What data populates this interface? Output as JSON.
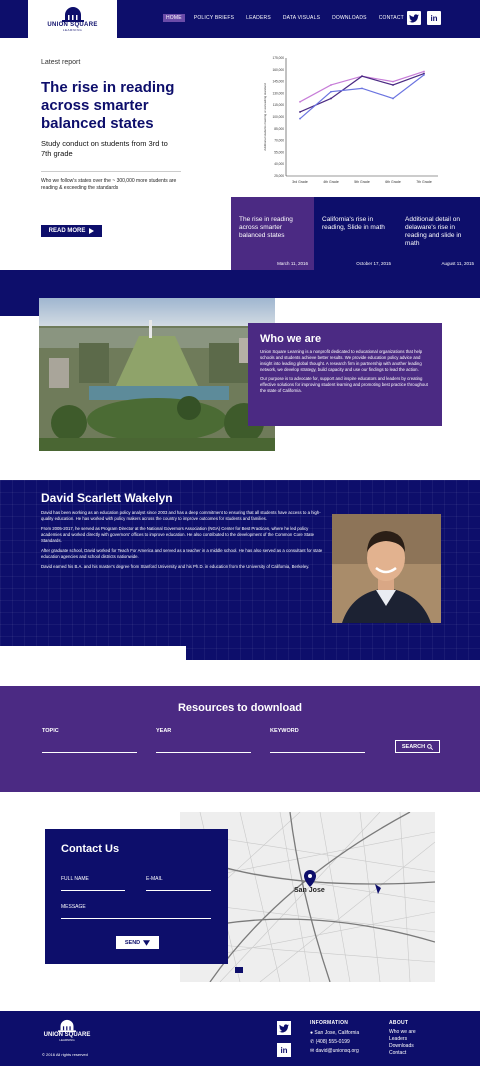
{
  "brand": {
    "name": "UNION SQUARE",
    "tagline": "LEARNING"
  },
  "nav": {
    "items": [
      "HOME",
      "POLICY BRIEFS",
      "LEADERS",
      "DATA VISUALS",
      "DOWNLOADS",
      "CONTACT"
    ],
    "active": "HOME",
    "social": [
      "twitter-icon",
      "linkedin-icon"
    ]
  },
  "hero": {
    "eyebrow": "Latest report",
    "title": "The rise in reading across smarter balanced states",
    "subtitle": "Study conduct on students from 3rd to 7th grade",
    "description": "Who we follow's states over the ~ 300,000 more students are reading & exceeding the standards",
    "cta": "READ MORE"
  },
  "chart_data": {
    "type": "line",
    "categories": [
      "3rd Grade",
      "4th Grade",
      "5th Grade",
      "6th Grade",
      "7th Grade"
    ],
    "ylim": [
      0,
      175000
    ],
    "yticks": [
      "175,000",
      "160,000",
      "145,000",
      "130,000",
      "115,000",
      "100,000",
      "85,000",
      "70,000",
      "55,000",
      "40,000",
      "25,000"
    ],
    "ylabel": "Additional students meeting or exceeding standard",
    "series": [
      {
        "name": "",
        "color": "#c77dd8",
        "values": [
          110000,
          135000,
          148000,
          140000,
          155000
        ]
      },
      {
        "name": "",
        "color": "#4b2a83",
        "values": [
          95000,
          115000,
          148000,
          135000,
          152000
        ]
      },
      {
        "name": "",
        "color": "#6b74e0",
        "values": [
          85000,
          125000,
          130000,
          115000,
          150000
        ]
      }
    ]
  },
  "cards": [
    {
      "title": "The rise in reading across smarter balanced states",
      "date": "March 11, 2016"
    },
    {
      "title": "California's rise in reading, Slide in math",
      "date": "October 17, 2015"
    },
    {
      "title": "Additional detail on delaware's rise in reading and slide in math",
      "date": "August 11, 2015"
    }
  ],
  "about": {
    "title": "Who we are",
    "p1": "Union Square Learning is a nonprofit dedicated to educational organizations that help schools and students achieve better results. We provide education policy advice and insight into leading global thought. A research firm in partnership with another leading network, we develop strategy, build capacity and use our findings to lead the action.",
    "p2": "Our purpose is to advocate for, support and inspire educators and leaders by creating effective solutions for improving student learning and promoting best practice throughout the state of California."
  },
  "bio": {
    "name": "David Scarlett Wakelyn",
    "p1": "David has been working as an education policy analyst since 2003 and has a deep commitment to ensuring that all students have access to a high-quality education. He has worked with policy makers across the country to improve outcomes for students and families.",
    "p2": "From 2005-2017, he served as Program Director at the National Governors Association (NGA) Center for Best Practices, where he led policy academies and worked directly with governors' offices to improve education. He also contributed to the development of the Common Core State Standards.",
    "p3": "After graduate school, David worked for Teach For America and served as a teacher in a middle school. He has also served as a consultant for state education agencies and school districts nationwide.",
    "p4": "David earned his B.A. and his master's degree from Stanford University and his Ph.D. in education from the University of California, Berkeley."
  },
  "resources": {
    "title": "Resources to download",
    "topic_label": "TOPIC",
    "year_label": "YEAR",
    "keyword_label": "KEYWORD",
    "search_label": "SEARCH"
  },
  "contact": {
    "title": "Contact Us",
    "fullname_label": "FULL NAME",
    "email_label": "E-MAIL",
    "message_label": "MESSAGE",
    "send_label": "SEND",
    "map_city": "San Jose"
  },
  "footer": {
    "copyright": "© 2016 All rights reserved",
    "info_title": "INFORMATION",
    "address": "San Jose, California",
    "phone": "(408) 555-0199",
    "email": "david@unionsq.org",
    "about_title": "ABOUT",
    "about_links": [
      "Who we are",
      "Leaders",
      "Downloads",
      "Contact"
    ]
  }
}
